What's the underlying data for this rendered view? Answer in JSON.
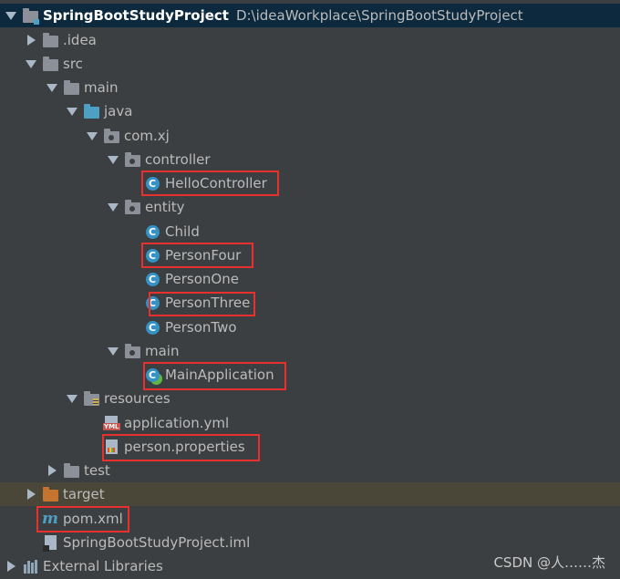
{
  "tree": {
    "rows": [
      {
        "label": "SpringBootStudyProject",
        "path": "D:\\ideaWorkplace\\SpringBootStudyProject",
        "icon": "module-folder-icon",
        "expanded": true
      },
      {
        "label": ".idea",
        "icon": "folder-icon",
        "expanded": false
      },
      {
        "label": "src",
        "icon": "folder-icon",
        "expanded": true
      },
      {
        "label": "main",
        "icon": "folder-icon",
        "expanded": true
      },
      {
        "label": "java",
        "icon": "source-folder-icon",
        "expanded": true
      },
      {
        "label": "com.xj",
        "icon": "package-icon",
        "expanded": true
      },
      {
        "label": "controller",
        "icon": "package-icon",
        "expanded": true
      },
      {
        "label": "HelloController",
        "icon": "class-icon"
      },
      {
        "label": "entity",
        "icon": "package-icon",
        "expanded": true
      },
      {
        "label": "Child",
        "icon": "class-icon"
      },
      {
        "label": "PersonFour",
        "icon": "class-icon"
      },
      {
        "label": "PersonOne",
        "icon": "class-icon"
      },
      {
        "label": "PersonThree",
        "icon": "class-icon"
      },
      {
        "label": "PersonTwo",
        "icon": "class-icon"
      },
      {
        "label": "main",
        "icon": "package-icon",
        "expanded": true
      },
      {
        "label": "MainApplication",
        "icon": "spring-boot-class-icon"
      },
      {
        "label": "resources",
        "icon": "resources-folder-icon",
        "expanded": true
      },
      {
        "label": "application.yml",
        "icon": "yml-file-icon"
      },
      {
        "label": "person.properties",
        "icon": "properties-file-icon"
      },
      {
        "label": "test",
        "icon": "folder-icon",
        "expanded": false
      },
      {
        "label": "target",
        "icon": "excluded-folder-icon",
        "expanded": false
      },
      {
        "label": "pom.xml",
        "icon": "maven-icon"
      },
      {
        "label": "SpringBootStudyProject.iml",
        "icon": "iml-file-icon"
      },
      {
        "label": "External Libraries",
        "icon": "libraries-icon",
        "expanded": false
      }
    ]
  },
  "highlighted": [
    "HelloController",
    "PersonFour",
    "PersonThree",
    "MainApplication",
    "person.properties",
    "pom.xml"
  ],
  "colors": {
    "background": "#3c3f41",
    "selection": "#0d293e",
    "highlight_box": "#e8302e",
    "class_icon": "#3592c4"
  },
  "watermark": "CSDN @人……杰"
}
